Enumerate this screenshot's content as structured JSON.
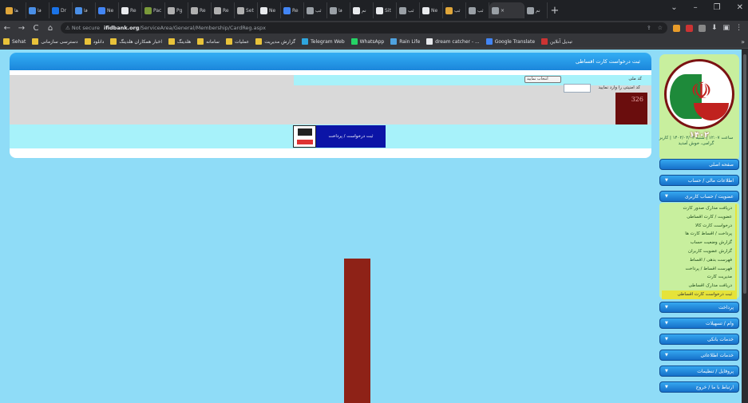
{
  "browser": {
    "tabs": [
      {
        "label": "ها",
        "color": "#e0a63a"
      },
      {
        "label": "فا",
        "color": "#4a8fe7"
      },
      {
        "label": "Dr",
        "color": "#1a73e8"
      },
      {
        "label": "فا",
        "color": "#4a8fe7"
      },
      {
        "label": "Ne",
        "color": "#4285f4"
      },
      {
        "label": "Re",
        "color": "#e8eaed"
      },
      {
        "label": "Pac",
        "color": "#7a9a3a"
      },
      {
        "label": "Pg",
        "color": "#b0b0b0"
      },
      {
        "label": "Re",
        "color": "#b0b0b0"
      },
      {
        "label": "Re",
        "color": "#b0b0b0"
      },
      {
        "label": "Set",
        "color": "#b0b0b0"
      },
      {
        "label": "Ne",
        "color": "#e8eaed"
      },
      {
        "label": "Re",
        "color": "#4285f4"
      },
      {
        "label": "ثب",
        "color": "#9aa0a6"
      },
      {
        "label": "فا",
        "color": "#9aa0a6"
      },
      {
        "label": "نم",
        "color": "#e8eaed"
      },
      {
        "label": "Sit",
        "color": "#e8eaed"
      },
      {
        "label": "ثب",
        "color": "#9aa0a6"
      },
      {
        "label": "Ne",
        "color": "#e8eaed"
      },
      {
        "label": "ثب",
        "color": "#e0a63a"
      },
      {
        "label": "ثب",
        "color": "#9aa0a6"
      }
    ],
    "active_tab": {
      "label": "×",
      "color": "#9aa0a6"
    },
    "extra_tab": {
      "label": "نم",
      "color": "#9aa0a6"
    },
    "new_tab": "+",
    "window_controls": [
      "⌄",
      "–",
      "❐",
      "✕"
    ],
    "nav": {
      "back": "←",
      "forward": "→",
      "reload": "C",
      "home": "⌂"
    },
    "address": {
      "security": "⚠ Not secure",
      "host": "ifidbank.org",
      "path": "/ServiceArea/General/Membership/CardReg.aspx"
    },
    "omnibox_icons": [
      "⇪",
      "☆"
    ],
    "extensions": [
      "#e89c2a",
      "#c33",
      "#888"
    ],
    "toolbar_icons": [
      "⬇",
      "▣",
      "⋮"
    ],
    "bookmarks": [
      {
        "label": "Sehat",
        "color": "#e8c23a"
      },
      {
        "label": "دسترسی سازمانی",
        "color": "#e8c23a"
      },
      {
        "label": "دانلود",
        "color": "#e8c23a"
      },
      {
        "label": "اخبار همکاران هلدینگ",
        "color": "#e8c23a"
      },
      {
        "label": "هلدینگ",
        "color": "#e8c23a"
      },
      {
        "label": "سامانه",
        "color": "#e8c23a"
      },
      {
        "label": "عملیات",
        "color": "#e8c23a"
      },
      {
        "label": "گزارش مدیریت",
        "color": "#e8c23a"
      },
      {
        "label": "Telegram Web",
        "color": "#2ea6de"
      },
      {
        "label": "WhatsApp",
        "color": "#25d366"
      },
      {
        "label": "Rain Life",
        "color": "#4fa3e0"
      },
      {
        "label": "dream catcher - ...",
        "color": "#e8eaed"
      },
      {
        "label": "Google Translate",
        "color": "#4285f4"
      },
      {
        "label": "تبدیل آنلاین",
        "color": "#c33"
      }
    ],
    "bookmarks_more": "»"
  },
  "sidebar": {
    "logo_year": "۱۴۰۲",
    "info": "ساعت ۱۲:۰۷ | شنبه ۱۴۰۲/۰۲/۰۲ | کاربر گرامی، خوش آمدید",
    "menu_top": [
      {
        "label": "صفحه اصلی",
        "arrow": ""
      },
      {
        "label": "اطلاعات مالی / حساب",
        "arrow": "▼"
      },
      {
        "label": "عضویت / حساب کاربری",
        "arrow": "▼"
      }
    ],
    "submenu": [
      "دریافت مدارک صدور کارت",
      "عضویت / کارت اقساطی",
      "درخواست کارت کالا",
      "پرداخت / اقساط کارت ها",
      "گزارش وضعیت حساب",
      "گزارش عضویت کاربران",
      "فهرست بدهی / اقساط",
      "فهرست اقساط / پرداخت",
      "مدیریت کارت",
      "دریافت مدارک اقساطی",
      "ثبت درخواست کارت اقساطی"
    ],
    "submenu_selected": 10,
    "menu_bottom": [
      {
        "label": "پرداخت",
        "arrow": "▼"
      },
      {
        "label": "وام / تسهیلات",
        "arrow": "▼"
      },
      {
        "label": "خدمات بانکی",
        "arrow": "▼"
      },
      {
        "label": "خدمات اطلاعاتی",
        "arrow": "▼"
      },
      {
        "label": "پروفایل / تنظیمات",
        "arrow": "▼"
      },
      {
        "label": "ارتباط با ما / خروج",
        "arrow": "▼"
      }
    ]
  },
  "panel": {
    "title": "ثبت درخواست کارت اقساطی",
    "user_label": "کد ملی",
    "captcha_label": "کد امنیتی را وارد نمایید",
    "select_value": "انتخاب نمایید",
    "captcha_text": "326",
    "banner_text": "ثبت درخواست / پرداخت"
  }
}
